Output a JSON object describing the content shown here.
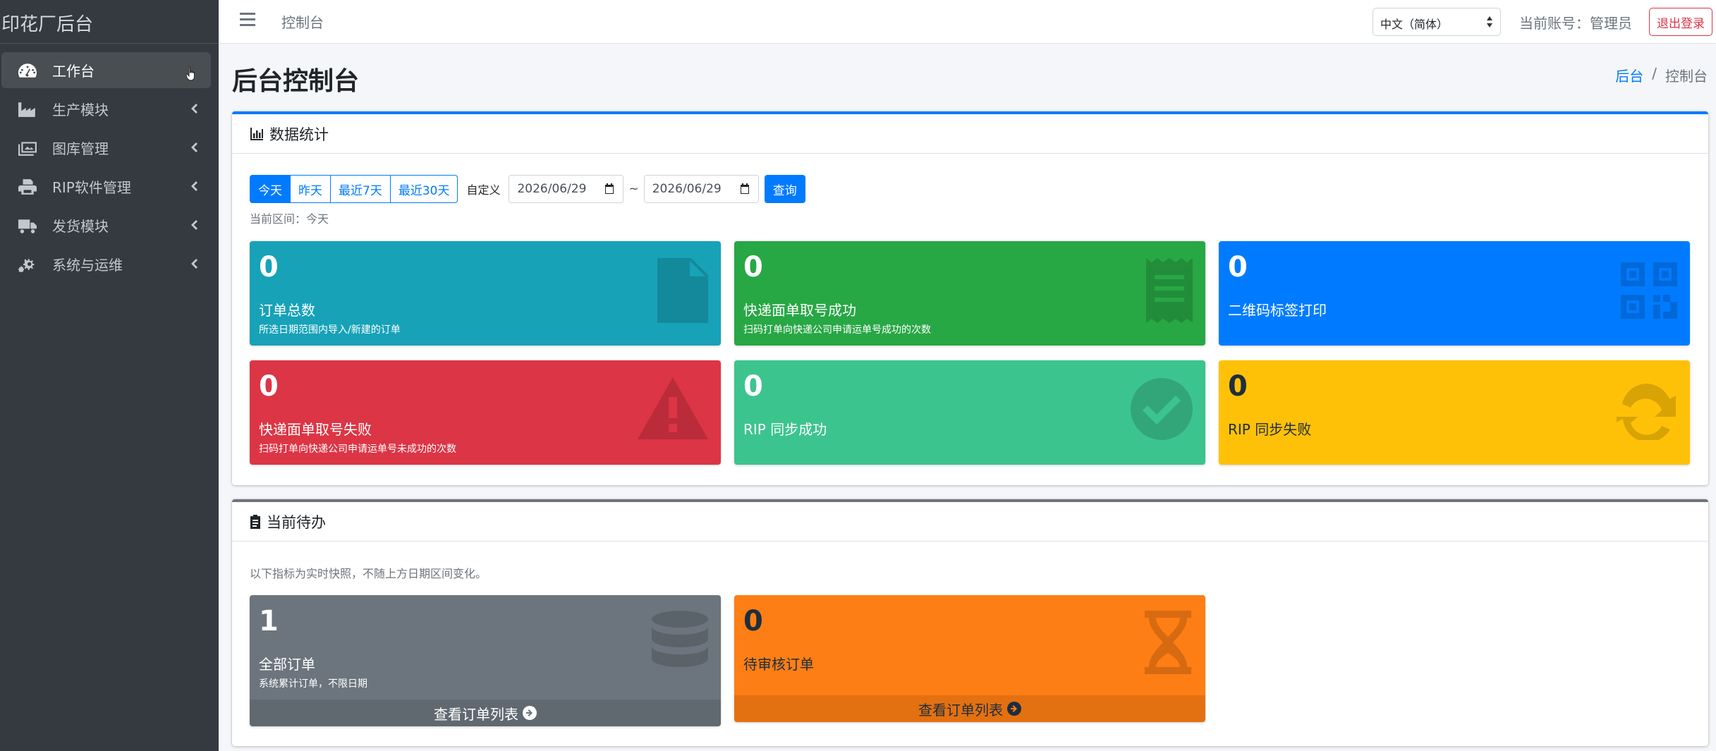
{
  "sidebar": {
    "brand": "印花厂后台",
    "items": [
      {
        "label": "工作台",
        "icon": "tachometer-icon"
      },
      {
        "label": "生产模块",
        "icon": "industry-icon"
      },
      {
        "label": "图库管理",
        "icon": "images-icon"
      },
      {
        "label": "RIP软件管理",
        "icon": "printer-icon"
      },
      {
        "label": "发货模块",
        "icon": "truck-icon"
      },
      {
        "label": "系统与运维",
        "icon": "gears-icon"
      }
    ]
  },
  "topbar": {
    "title": "控制台",
    "language": "中文（简体）",
    "account": "当前账号：管理员",
    "logout": "退出登录"
  },
  "page": {
    "title": "后台控制台",
    "breadcrumb": {
      "home": "后台",
      "separator": "/",
      "current": "控制台"
    }
  },
  "stats": {
    "header": "数据统计",
    "filters": {
      "buttons": [
        "今天",
        "昨天",
        "最近7天",
        "最近30天"
      ],
      "active": "今天",
      "custom_label": "自定义",
      "date_from": "2026/06/29",
      "separator": "~",
      "date_to": "2026/06/29",
      "query": "查询"
    },
    "range_text": "当前区间：今天",
    "boxes": [
      {
        "value": "0",
        "label": "订单总数",
        "sub": "所选日期范围内导入/新建的订单",
        "color": "#17a2b8",
        "icon": "file-invoice-icon"
      },
      {
        "value": "0",
        "label": "快递面单取号成功",
        "sub": "扫码打单向快递公司申请运单号成功的次数",
        "color": "#28a745",
        "icon": "receipt-icon"
      },
      {
        "value": "0",
        "label": "二维码标签打印",
        "sub": "",
        "color": "#007bff",
        "icon": "qrcode-icon"
      },
      {
        "value": "0",
        "label": "快递面单取号失败",
        "sub": "扫码打单向快递公司申请运单号未成功的次数",
        "color": "#dc3545",
        "icon": "warning-icon"
      },
      {
        "value": "0",
        "label": "RIP 同步成功",
        "sub": "",
        "color": "#3cc48f",
        "icon": "check-circle-icon"
      },
      {
        "value": "0",
        "label": "RIP 同步失败",
        "sub": "",
        "color": "#ffc107",
        "icon": "sync-icon"
      }
    ]
  },
  "todo": {
    "header": "当前待办",
    "note": "以下指标为实时快照，不随上方日期区间变化。",
    "boxes": [
      {
        "value": "1",
        "label": "全部订单",
        "sub": "系统累计订单，不限日期",
        "footer": "查看订单列表",
        "color": "#6c757d",
        "icon": "database-icon"
      },
      {
        "value": "0",
        "label": "待审核订单",
        "sub": "",
        "footer": "查看订单列表",
        "color": "#fd7e14",
        "icon": "hourglass-icon"
      }
    ]
  }
}
